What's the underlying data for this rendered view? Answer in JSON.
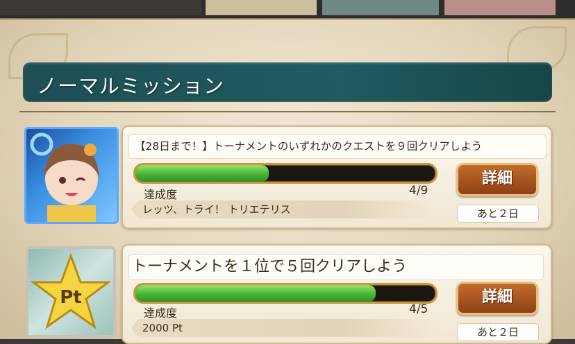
{
  "section": {
    "title": "ノーマルミッション"
  },
  "missions": [
    {
      "description": "【28日まで！】トーナメントのいずれかのクエストを９回クリアしよう",
      "progress_label": "達成度",
      "progress_text": "4/9",
      "progress_fraction": 0.444,
      "reward": "レッツ、トライ！ トリエテリス",
      "detail_button": "詳細",
      "remaining": "あと２日",
      "icon": "character-portrait-icon"
    },
    {
      "description": "トーナメントを１位で５回クリアしよう",
      "progress_label": "達成度",
      "progress_text": "4/5",
      "progress_fraction": 0.8,
      "reward": "2000 Pt",
      "detail_button": "詳細",
      "remaining": "あと２日",
      "icon": "pt-star-icon",
      "icon_text": "Pt"
    }
  ],
  "colors": {
    "header": "#1f5b60",
    "progress_fill": "#47b53a",
    "button": "#a84e1c"
  }
}
